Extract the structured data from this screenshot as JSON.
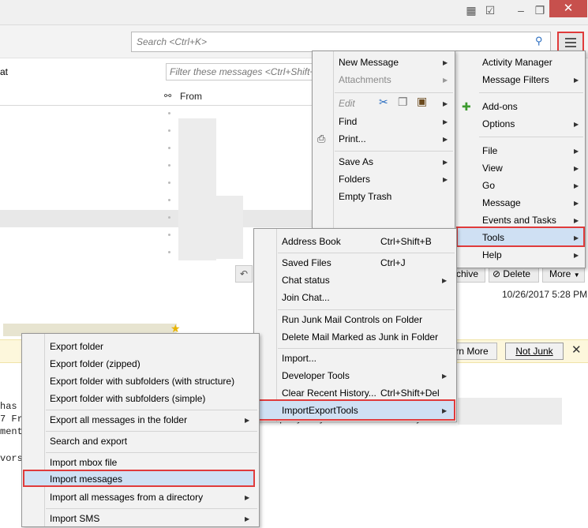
{
  "search": {
    "placeholder": "Search <Ctrl+K>"
  },
  "filter": {
    "placeholder": "Filter these messages <Ctrl+Shift+"
  },
  "list": {
    "left_label": "at",
    "from_header": "From"
  },
  "header_actions": {
    "archive": "chive",
    "delete": "Delete",
    "more": "More"
  },
  "message": {
    "date": "10/26/2017 5:28 PM"
  },
  "junk_bar": {
    "learn_more": "rn More",
    "not_junk": "Not Junk"
  },
  "body_text": {
    "line1": "has",
    "line2": "7 Fr",
    "line3": "ment",
    "line4": "vors",
    "line5": "e company buy Facebook and any"
  },
  "main_menu": {
    "items": [
      "Activity Manager",
      "Message Filters",
      "Add-ons",
      "Options",
      "File",
      "View",
      "Go",
      "Message",
      "Events and Tasks",
      "Tools",
      "Help"
    ]
  },
  "file_menu": {
    "new_message": "New Message",
    "attachments": "Attachments",
    "edit": "Edit",
    "find": "Find",
    "print": "Print...",
    "save_as": "Save As",
    "folders": "Folders",
    "empty_trash": "Empty Trash"
  },
  "tools_menu": {
    "address_book": "Address Book",
    "address_book_sc": "Ctrl+Shift+B",
    "saved_files": "Saved Files",
    "saved_files_sc": "Ctrl+J",
    "chat_status": "Chat status",
    "join_chat": "Join Chat...",
    "run_junk": "Run Junk Mail Controls on Folder",
    "delete_junk": "Delete Mail Marked as Junk in Folder",
    "import": "Import...",
    "developer_tools": "Developer Tools",
    "clear_history": "Clear Recent History...",
    "clear_history_sc": "Ctrl+Shift+Del",
    "importexport": "ImportExportTools"
  },
  "iet_menu": {
    "export_folder": "Export folder",
    "export_folder_zipped": "Export folder (zipped)",
    "export_sub_structure": "Export folder with subfolders (with structure)",
    "export_sub_simple": "Export folder with subfolders (simple)",
    "export_all": "Export all messages in the folder",
    "search_export": "Search and export",
    "import_mbox": "Import mbox file",
    "import_messages": "Import messages",
    "import_all_dir": "Import all messages from a directory",
    "import_sms": "Import SMS"
  },
  "colors": {
    "highlight_border": "#e03b3b",
    "hover_blue": "#cfe0f3",
    "close_red": "#c7504d"
  }
}
